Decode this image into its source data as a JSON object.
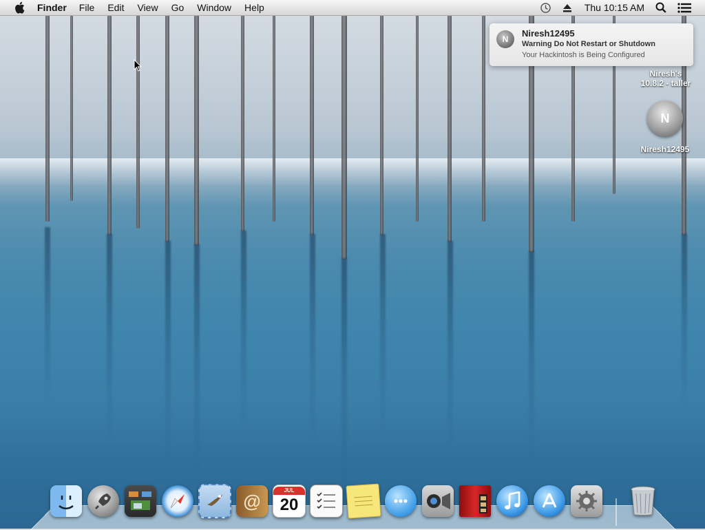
{
  "menubar": {
    "app_name": "Finder",
    "menus": [
      "File",
      "Edit",
      "View",
      "Go",
      "Window",
      "Help"
    ],
    "clock": "Thu 10:15 AM"
  },
  "notification": {
    "title": "Niresh12495",
    "subtitle": "Warning Do Not Restart or Shutdown",
    "body": "Your Hackintosh is Being Configured"
  },
  "desktop": {
    "installer_label_line1": "Niresh's",
    "installer_label_line2": "10.8.2 - taller",
    "disk_label": "Niresh12495"
  },
  "dock": {
    "calendar_day": "20",
    "calendar_month": "JUL",
    "items": [
      "Finder",
      "Launchpad",
      "Mission Control",
      "Safari",
      "Mail",
      "Contacts",
      "Calendar",
      "Reminders",
      "Notes",
      "Messages",
      "FaceTime",
      "Photo Booth",
      "iTunes",
      "App Store",
      "System Preferences",
      "Trash"
    ]
  },
  "colors": {
    "menubar_top": "#f6f6f6",
    "menubar_bottom": "#d6d6d6",
    "water": "#3f85ad",
    "snow": "#d7dde3"
  }
}
